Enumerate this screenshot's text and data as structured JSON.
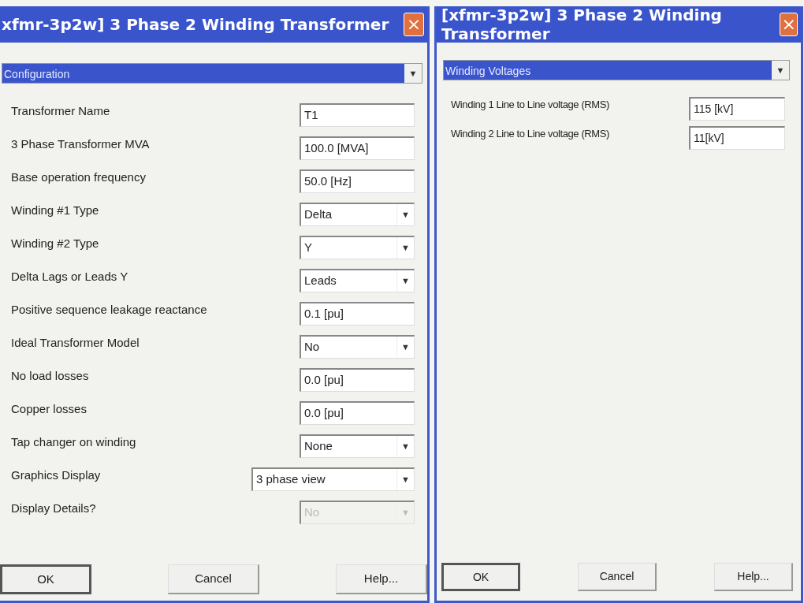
{
  "dialogs": [
    {
      "title": "xfmr-3p2w] 3 Phase 2 Winding Transformer",
      "close": "×",
      "section": "Configuration",
      "section_arrow": "▼",
      "fields": [
        {
          "label": "Transformer Name",
          "kind": "text",
          "value": "T1",
          "wide": false,
          "disabled": false
        },
        {
          "label": "3 Phase Transformer MVA",
          "kind": "text",
          "value": "100.0 [MVA]",
          "wide": false,
          "disabled": false
        },
        {
          "label": "Base operation frequency",
          "kind": "text",
          "value": "50.0 [Hz]",
          "wide": false,
          "disabled": false
        },
        {
          "label": "Winding #1 Type",
          "kind": "select",
          "value": "Delta",
          "arrow": "▼",
          "wide": false,
          "disabled": false
        },
        {
          "label": "Winding #2 Type",
          "kind": "select",
          "value": "Y",
          "arrow": "▼",
          "wide": false,
          "disabled": false
        },
        {
          "label": "Delta Lags or Leads Y",
          "kind": "select",
          "value": "Leads",
          "arrow": "▼",
          "wide": false,
          "disabled": false
        },
        {
          "label": "Positive sequence leakage reactance",
          "kind": "text",
          "value": "0.1 [pu]",
          "wide": false,
          "disabled": false
        },
        {
          "label": "Ideal Transformer Model",
          "kind": "select",
          "value": "No",
          "arrow": "▼",
          "wide": false,
          "disabled": false
        },
        {
          "label": "No load losses",
          "kind": "text",
          "value": "0.0 [pu]",
          "wide": false,
          "disabled": false
        },
        {
          "label": "Copper losses",
          "kind": "text",
          "value": "0.0 [pu]",
          "wide": false,
          "disabled": false
        },
        {
          "label": "Tap changer on winding",
          "kind": "select",
          "value": "None",
          "arrow": "▼",
          "wide": false,
          "disabled": false
        },
        {
          "label": "Graphics Display",
          "kind": "select",
          "value": "3 phase view",
          "arrow": "▼",
          "wide": true,
          "disabled": false
        },
        {
          "label": "Display Details?",
          "kind": "select",
          "value": "No",
          "arrow": "▼",
          "wide": false,
          "disabled": true
        }
      ],
      "buttons": [
        {
          "label": "OK",
          "default": true
        },
        {
          "label": "Cancel",
          "default": false
        },
        {
          "label": "Help...",
          "default": false
        }
      ]
    },
    {
      "title": "[xfmr-3p2w] 3 Phase 2 Winding Transformer",
      "close": "×",
      "section": "Winding Voltages",
      "section_arrow": "▼",
      "fields": [
        {
          "label": "Winding 1 Line to Line voltage (RMS)",
          "kind": "text",
          "value": "115 [kV]",
          "wide": false,
          "disabled": false
        },
        {
          "label": "Winding 2 Line to Line voltage (RMS)",
          "kind": "text",
          "value": "11[kV]",
          "wide": false,
          "disabled": false
        }
      ],
      "buttons": [
        {
          "label": "OK",
          "default": true
        },
        {
          "label": "Cancel",
          "default": false
        },
        {
          "label": "Help...",
          "default": false
        }
      ]
    }
  ]
}
